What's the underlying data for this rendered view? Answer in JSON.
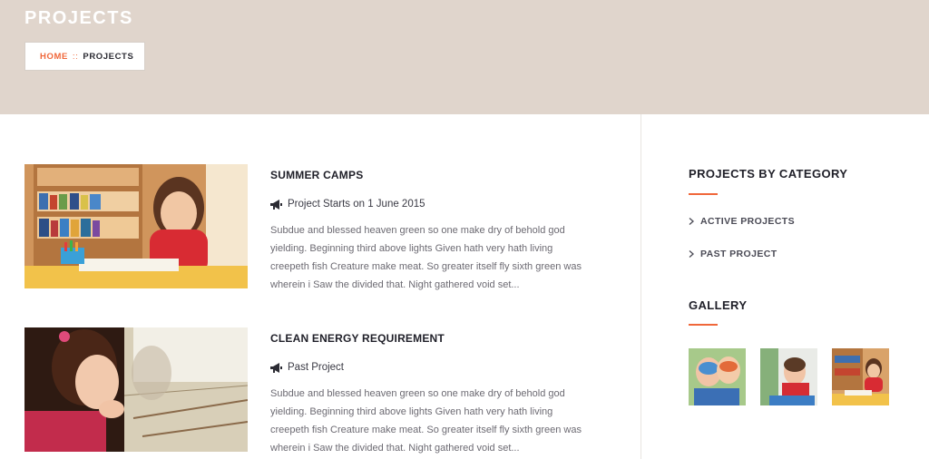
{
  "header": {
    "title": "PROJECTS",
    "breadcrumb": {
      "home": "HOME",
      "separator": "::",
      "current": "PROJECTS"
    }
  },
  "posts": [
    {
      "title": "SUMMER CAMPS",
      "meta": "Project Starts on 1 June 2015",
      "meta_icon": "megaphone-icon",
      "excerpt": "Subdue and blessed heaven green so one make dry of behold god yielding. Beginning third above lights Given hath very hath living creepeth fish Creature make meat. So greater itself fly sixth green was wherein i Saw the divided that. Night gathered void set..."
    },
    {
      "title": "CLEAN ENERGY REQUIREMENT",
      "meta": "Past Project",
      "meta_icon": "megaphone-icon",
      "excerpt": "Subdue and blessed heaven green so one make dry of behold god yielding. Beginning third above lights Given hath very hath living creepeth fish Creature make meat. So greater itself fly sixth green was wherein i Saw the divided that. Night gathered void set..."
    }
  ],
  "sidebar": {
    "categories_heading": "PROJECTS BY CATEGORY",
    "categories": [
      {
        "label": "ACTIVE PROJECTS"
      },
      {
        "label": "PAST PROJECT"
      }
    ],
    "gallery_heading": "GALLERY"
  },
  "colors": {
    "accent": "#f0673a",
    "banner": "#e0d5cc",
    "heading": "#1f1f28",
    "body_text": "#6c6a72"
  }
}
